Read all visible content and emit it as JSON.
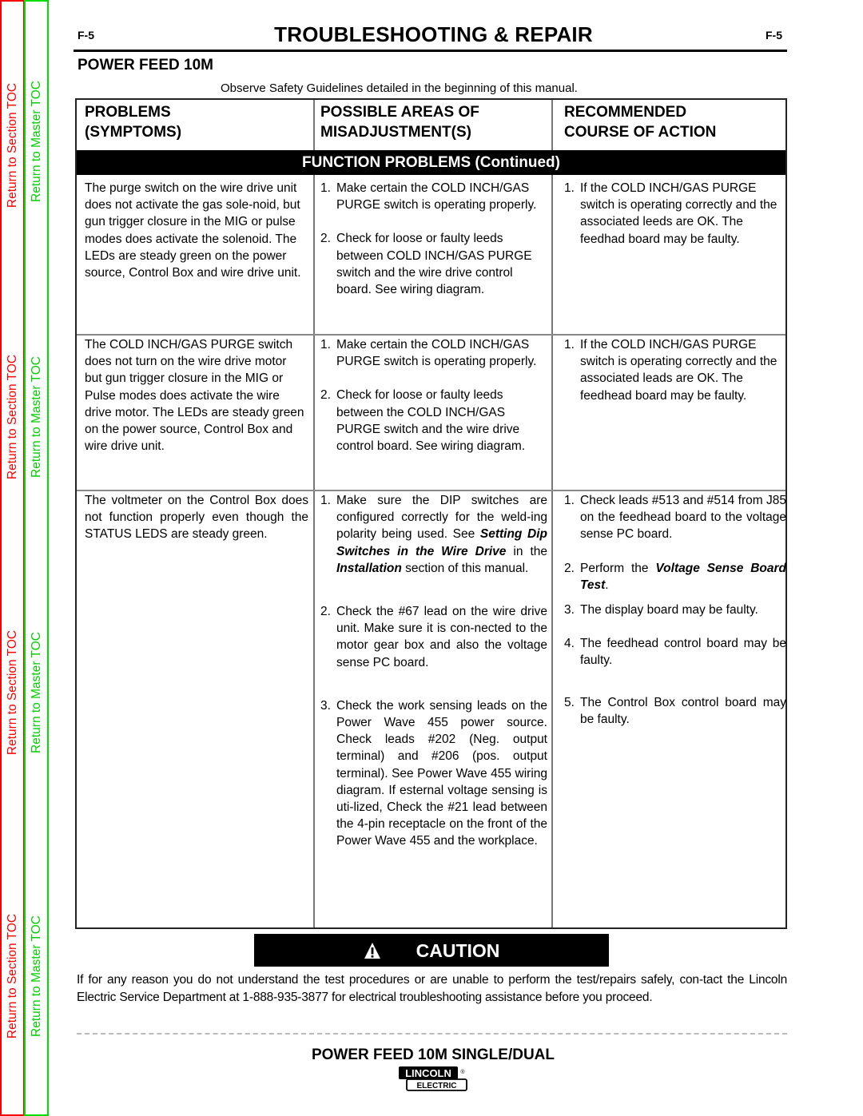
{
  "toc": {
    "section_label": "Return to Section TOC",
    "master_label": "Return to Master TOC",
    "colors": {
      "section": "#ff0000",
      "master": "#00d000"
    }
  },
  "header": {
    "page_left": "F-5",
    "page_right": "F-5",
    "title": "TROUBLESHOOTING & REPAIR",
    "subtitle": "POWER FEED 10M",
    "safety_note": "Observe Safety Guidelines detailed in the beginning of this manual."
  },
  "table": {
    "columns": [
      {
        "line1": "PROBLEMS",
        "line2": "(SYMPTOMS)"
      },
      {
        "line1": "POSSIBLE AREAS OF",
        "line2": "MISADJUSTMENT(S)"
      },
      {
        "line1": "RECOMMENDED",
        "line2": "COURSE OF ACTION"
      }
    ],
    "section_title": "FUNCTION PROBLEMS (Continued)",
    "rows": [
      {
        "problem": "The purge switch on the wire drive unit does not activate the gas sole-noid, but gun trigger closure in the MIG or pulse modes does activate the solenoid.  The LEDs are steady green on the power source, Control Box and wire drive unit.",
        "causes": [
          {
            "num": "1.",
            "text": "Make certain the COLD INCH/GAS PURGE switch is operating properly."
          },
          {
            "num": "2.",
            "text": "Check for loose or faulty leeds between COLD INCH/GAS PURGE switch and the wire drive control board.  See wiring diagram."
          }
        ],
        "actions": [
          {
            "num": "1.",
            "text": "If the COLD INCH/GAS PURGE switch is operating correctly and the associated leeds are OK. The feedhad board may be faulty."
          }
        ]
      },
      {
        "problem": "The COLD INCH/GAS PURGE switch does not turn on the wire drive motor but gun trigger closure in the MIG or Pulse modes does activate the wire drive motor. The LEDs are steady green on the power source, Control Box and wire drive unit.",
        "causes": [
          {
            "num": "1.",
            "text": "Make certain the COLD INCH/GAS PURGE switch is operating properly."
          },
          {
            "num": "2.",
            "text": "Check for loose or faulty leeds between the COLD INCH/GAS PURGE switch and the wire drive control board.  See wiring diagram."
          }
        ],
        "actions": [
          {
            "num": "1.",
            "text": "If the COLD INCH/GAS PURGE switch is operating correctly and the associated leads are OK. The feedhead board may be faulty."
          }
        ]
      },
      {
        "problem": "The voltmeter on the Control Box does not function properly even though the STATUS LEDS are steady green.",
        "causes": [
          {
            "num": "1.",
            "text_before": "Make sure the DIP switches are configured correctly for the weld-ing polarity being used.  See ",
            "ref1": "Setting Dip Switches in the Wire Drive",
            "text_mid": " in the ",
            "ref2": "Installation",
            "text_after": " section of this manual."
          },
          {
            "num": "2.",
            "text": "Check the #67 lead on the wire drive unit. Make sure it is con-nected to the motor gear box and also the voltage sense PC board."
          },
          {
            "num": "3.",
            "text": "Check the work sensing leads on the Power Wave 455 power source.  Check leads #202 (Neg. output terminal) and #206 (pos. output terminal).  See Power Wave 455 wiring diagram.  If esternal voltage sensing is uti-lized, Check the #21 lead between the 4-pin receptacle on the front of the Power Wave 455 and the workplace."
          }
        ],
        "actions": [
          {
            "num": "1.",
            "text": "Check leads #513 and #514 from J85 on the feedhead board to the voltage sense PC board."
          },
          {
            "num": "2.",
            "text_before": "Perform the ",
            "ref": "Voltage Sense Board Test",
            "text_after": "."
          },
          {
            "num": "3.",
            "text": "The display board may be faulty."
          },
          {
            "num": "4.",
            "text": "The feedhead control board may be faulty."
          },
          {
            "num": "5.",
            "text": "The Control Box control board may be faulty."
          }
        ]
      }
    ]
  },
  "caution": {
    "icon": "warning-triangle-icon",
    "label": "CAUTION",
    "note": "If for any reason you do not understand the test procedures or are unable to perform the test/repairs safely, con-tact the Lincoln Electric Service Department at 1-888-935-3877 for electrical troubleshooting assistance before you proceed."
  },
  "footer": {
    "title": "POWER FEED 10M SINGLE/DUAL",
    "logo_top": "LINCOLN",
    "logo_bottom": "ELECTRIC",
    "logo_mark": "®"
  }
}
